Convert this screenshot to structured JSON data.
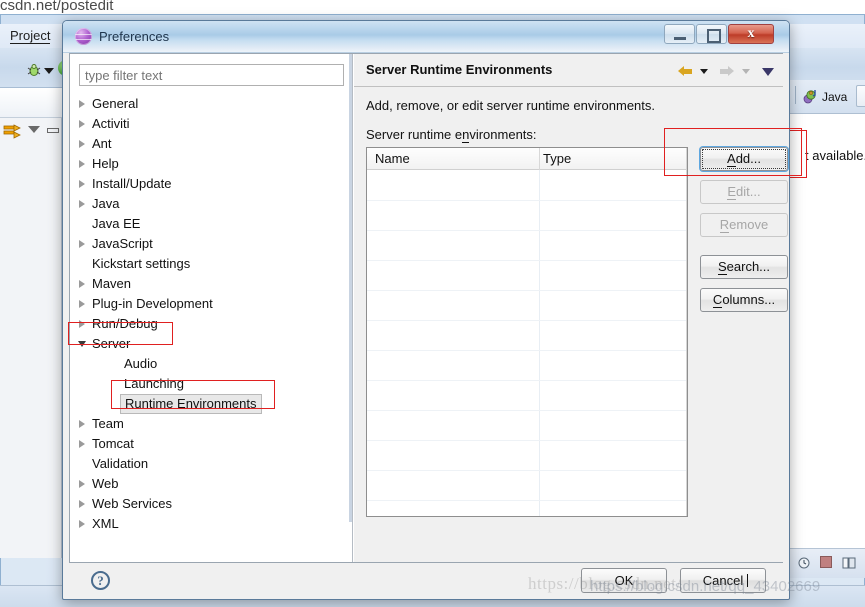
{
  "background": {
    "browser_url": "csdn.net/postedit",
    "menu_project": "Project",
    "perspective_label": "Java",
    "editor_text": "t available.",
    "icons": {
      "debug": "debug-bug-icon",
      "run": "run-circle-icon",
      "explorer": "explorer-icon",
      "perspective": "java-perspective-icon"
    }
  },
  "dialog": {
    "title": "Preferences",
    "icon": "preferences-sphere-icon",
    "window_buttons": {
      "minimize": "minimize-icon",
      "maximize": "maximize-icon",
      "close": "x"
    }
  },
  "tree": {
    "filter_placeholder": "type filter text",
    "filter_value": "",
    "items": [
      {
        "label": "General",
        "indent": 0,
        "twisty": "closed",
        "selected": false
      },
      {
        "label": "Activiti",
        "indent": 0,
        "twisty": "closed",
        "selected": false
      },
      {
        "label": "Ant",
        "indent": 0,
        "twisty": "closed",
        "selected": false
      },
      {
        "label": "Help",
        "indent": 0,
        "twisty": "closed",
        "selected": false
      },
      {
        "label": "Install/Update",
        "indent": 0,
        "twisty": "closed",
        "selected": false
      },
      {
        "label": "Java",
        "indent": 0,
        "twisty": "closed",
        "selected": false
      },
      {
        "label": "Java EE",
        "indent": 0,
        "twisty": "none",
        "selected": false
      },
      {
        "label": "JavaScript",
        "indent": 0,
        "twisty": "closed",
        "selected": false
      },
      {
        "label": "Kickstart settings",
        "indent": 0,
        "twisty": "none",
        "selected": false
      },
      {
        "label": "Maven",
        "indent": 0,
        "twisty": "closed",
        "selected": false
      },
      {
        "label": "Plug-in Development",
        "indent": 0,
        "twisty": "closed",
        "selected": false
      },
      {
        "label": "Run/Debug",
        "indent": 0,
        "twisty": "closed",
        "selected": false
      },
      {
        "label": "Server",
        "indent": 0,
        "twisty": "open",
        "selected": false
      },
      {
        "label": "Audio",
        "indent": 1,
        "twisty": "none",
        "selected": false
      },
      {
        "label": "Launching",
        "indent": 1,
        "twisty": "none",
        "selected": false
      },
      {
        "label": "Runtime Environments",
        "indent": 1,
        "twisty": "none",
        "selected": true
      },
      {
        "label": "Team",
        "indent": 0,
        "twisty": "closed",
        "selected": false
      },
      {
        "label": "Tomcat",
        "indent": 0,
        "twisty": "closed",
        "selected": false
      },
      {
        "label": "Validation",
        "indent": 0,
        "twisty": "none",
        "selected": false
      },
      {
        "label": "Web",
        "indent": 0,
        "twisty": "closed",
        "selected": false
      },
      {
        "label": "Web Services",
        "indent": 0,
        "twisty": "closed",
        "selected": false
      },
      {
        "label": "XML",
        "indent": 0,
        "twisty": "closed",
        "selected": false
      }
    ]
  },
  "page": {
    "title": "Server Runtime Environments",
    "description": "Add, remove, or edit server runtime environments.",
    "list_label_pre": "Server runtime e",
    "list_label_mnemonic": "n",
    "list_label_post": "vironments:",
    "nav": {
      "back_icon": "back-arrow-icon",
      "back_dropdown_icon": "chevron-down-icon",
      "forward_icon": "forward-arrow-icon",
      "forward_dropdown_icon": "chevron-down-icon",
      "menu_icon": "view-menu-chevron-icon"
    }
  },
  "table": {
    "columns": [
      "Name",
      "Type"
    ],
    "rows": []
  },
  "side_buttons": [
    {
      "name": "add",
      "pre": "",
      "mnemonic": "A",
      "post": "dd...",
      "enabled": true,
      "focused": true
    },
    {
      "name": "edit",
      "pre": "",
      "mnemonic": "E",
      "post": "dit...",
      "enabled": false,
      "focused": false
    },
    {
      "name": "remove",
      "pre": "",
      "mnemonic": "R",
      "post": "emove",
      "enabled": false,
      "focused": false
    },
    {
      "name": "search",
      "pre": "",
      "mnemonic": "S",
      "post": "earch...",
      "enabled": true,
      "focused": false
    },
    {
      "name": "columns",
      "pre": "",
      "mnemonic": "C",
      "post": "olumns...",
      "enabled": true,
      "focused": false
    }
  ],
  "footer": {
    "help_icon": "?",
    "ok_label": "OK",
    "cancel_label": "Cancel"
  },
  "annotations": {
    "color": "#e02020",
    "regions": [
      "add-button",
      "server-tree-node",
      "runtime-environments-tree-node"
    ]
  },
  "watermark": {
    "text": "https://blog.csdn.net/",
    "text2": "https://blog.csdn.net/qq_43402669"
  }
}
